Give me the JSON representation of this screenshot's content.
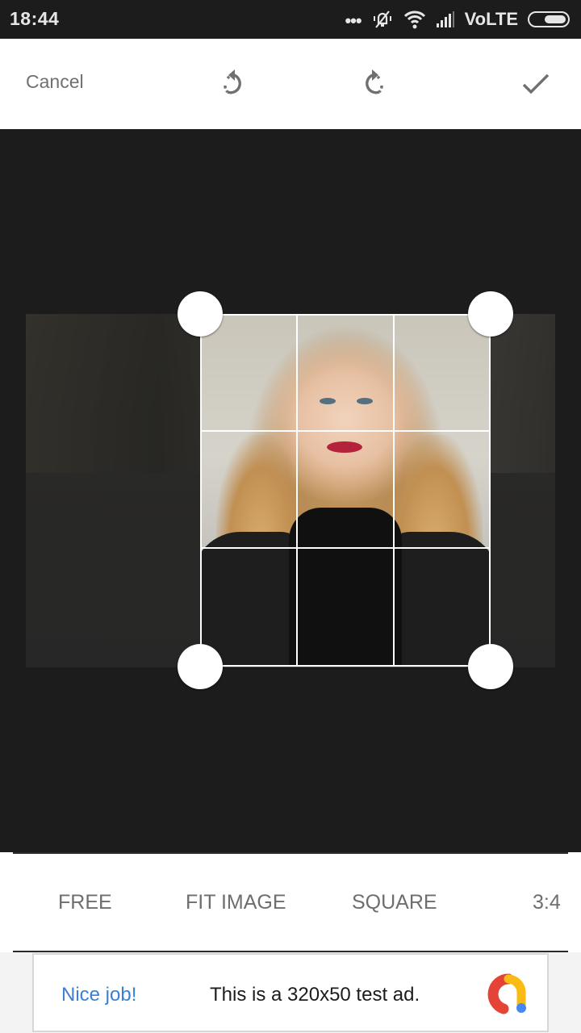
{
  "status_bar": {
    "time": "18:44",
    "overflow_dots": "•••",
    "network_label": "VoLTE",
    "icons": [
      "notifications-muted-icon",
      "wifi-icon",
      "cell-signal-icon",
      "battery-icon"
    ]
  },
  "toolbar": {
    "cancel_label": "Cancel",
    "rotate_left_icon": "rotate-left-icon",
    "rotate_right_icon": "rotate-right-icon",
    "confirm_icon": "check-icon"
  },
  "editor": {
    "mode": "crop",
    "grid": "rule-of-thirds",
    "image_description": "Portrait of a woman with long wavy blonde hair and red lipstick, black jacket"
  },
  "aspect_options": [
    {
      "label": "FREE"
    },
    {
      "label": "FIT IMAGE"
    },
    {
      "label": "SQUARE"
    },
    {
      "label": "3:4"
    }
  ],
  "ad": {
    "title": "Nice job!",
    "text": "This is a 320x50 test ad.",
    "colors": {
      "title": "#3b7fd6",
      "logo_red": "#e54335",
      "logo_yellow": "#f9bb14",
      "logo_blue": "#4688f1"
    }
  }
}
